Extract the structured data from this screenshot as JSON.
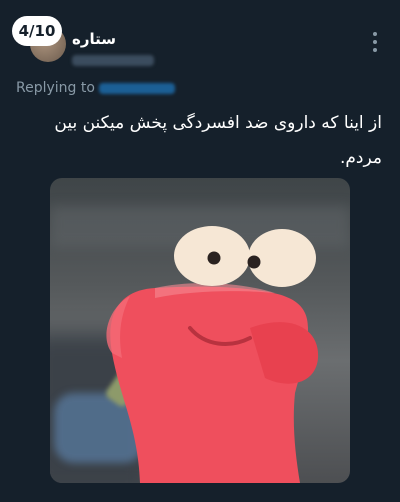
{
  "tweet": {
    "counter": "4/10",
    "author_name": "ستاره",
    "replying_label": "Replying to",
    "text": "از اینا که داروی ضد افسردگی پخش میکنن بین مردم."
  },
  "colors": {
    "background": "#15202b",
    "secondary_text": "#8899a6",
    "link": "#1d9bf0",
    "creature": "#ef4f5d"
  },
  "media": {
    "type": "image",
    "description_icon": "red-clay-creature"
  }
}
